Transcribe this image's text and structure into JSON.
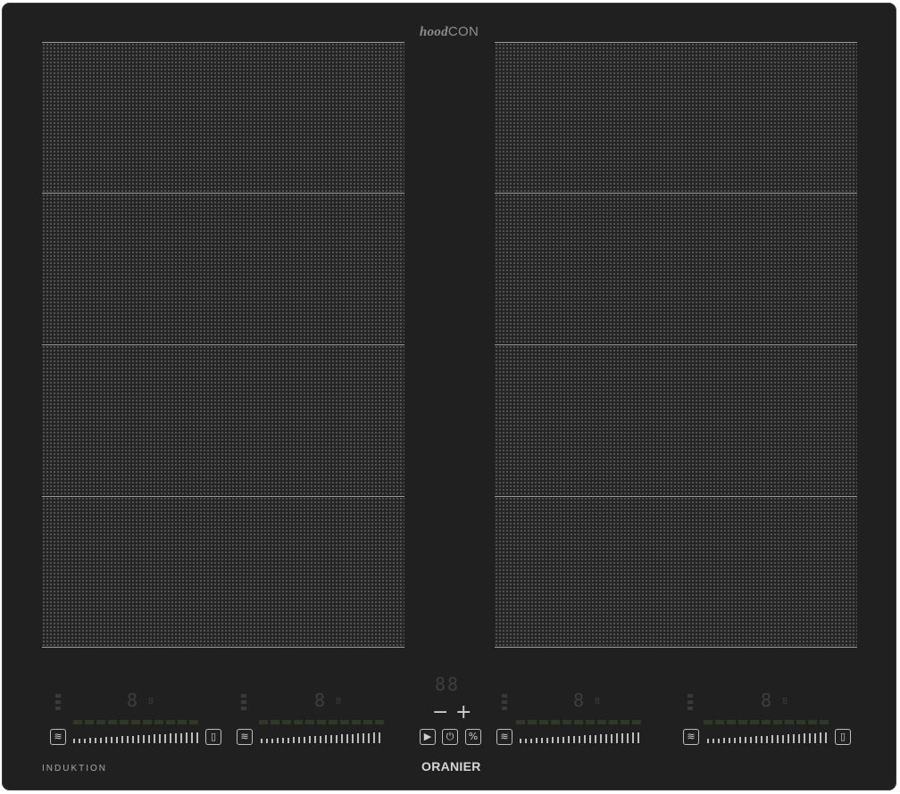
{
  "brand_top": {
    "part1": "hood",
    "part2": "CON"
  },
  "label_left": "INDUKTION",
  "label_brand": "ORANIER",
  "controls": {
    "digit": "8",
    "digit_suffix": "8",
    "timer_digits": "88",
    "minus": "−",
    "plus": "+",
    "icons": [
      "heat-wave-icon",
      "pot-icon",
      "play-icon",
      "power-icon",
      "settings-icon"
    ]
  },
  "colors": {
    "panel": "#202020",
    "zone_line": "#9a9a9a",
    "icon": "#bdbdbd"
  }
}
